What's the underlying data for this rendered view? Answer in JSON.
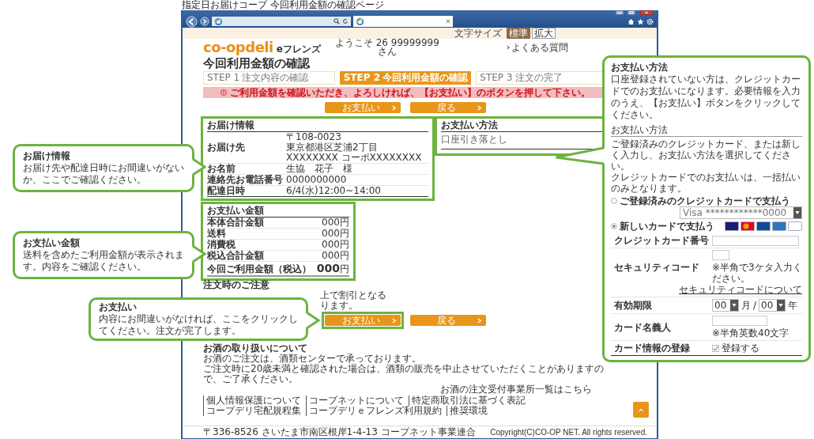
{
  "caption": "指定日お届けコープ 今回利用金額の確認ページ",
  "font_size": {
    "label": "文字サイズ",
    "options": [
      {
        "label": "標準",
        "selected": true
      },
      {
        "label": "拡大",
        "selected": false
      }
    ]
  },
  "header": {
    "logo": "co-opdeli",
    "logo_sub": "eフレンズ",
    "welcome": "ようこそ 26 99999999",
    "welcome_suffix": "さん",
    "faq_link": "よくある質問"
  },
  "page_title": "今回利用金額の確認",
  "steps": [
    {
      "step": "STEP 1",
      "label": "注文内容の確認",
      "selected": false
    },
    {
      "step": "STEP 2",
      "label": "今回利用金額の確認",
      "selected": true
    },
    {
      "step": "STEP 3",
      "label": "注文の完了",
      "selected": false
    }
  ],
  "alert": "ご利用金額を確認いただき、よろしければ、【お支払い】のボタンを押して下さい。",
  "actions_top": [
    {
      "label": "お支払い",
      "highlighted": false
    },
    {
      "label": "戻る",
      "highlighted": false
    }
  ],
  "delivery": {
    "title": "お届け情報",
    "highlighted": true,
    "rows": [
      {
        "label": "お届け先",
        "lines": [
          "〒108-0023",
          "東京都港区芝浦2丁目 XXXXXXXX コーポXXXXXXXX"
        ]
      },
      {
        "label": "お名前",
        "lines": [
          "生協　花子　様"
        ]
      },
      {
        "label": "連絡先お電話番号",
        "lines": [
          "0000000000"
        ]
      },
      {
        "label": "配達日時",
        "lines": [
          "6/4(水)12:00~14:00"
        ]
      }
    ]
  },
  "payment_method": {
    "title": "お支払い方法",
    "value": "口座引き落とし",
    "highlighted": true
  },
  "amount": {
    "title": "お支払い金額",
    "highlighted": true,
    "rows": [
      {
        "label": "本体合計金額",
        "value": "000円"
      },
      {
        "label": "送料",
        "value": "000円"
      },
      {
        "label": "消費税",
        "value": "000円"
      },
      {
        "label": "税込合計金額",
        "value": "000円"
      }
    ],
    "total": {
      "label": "今回ご利用金額（税込）",
      "value": "000",
      "unit": "円"
    }
  },
  "notes": {
    "title": "注文時のご注意",
    "lines": [
      "上で割引となる",
      "ります。"
    ]
  },
  "actions_bottom": [
    {
      "label": "お支払い",
      "highlighted": true
    },
    {
      "label": "戻る",
      "highlighted": false
    }
  ],
  "alcohol": {
    "title": "お酒の取り扱いについて",
    "lines": [
      "お酒のご注文は、酒類センターで承っております。",
      "ご注文時に20歳未満と確認された場合は、酒類の販売を中止させていただくことがありますので、ご了承ください。"
    ],
    "link": "お酒の注文受付事業所一覧はこちら"
  },
  "footer_links": [
    "個人情報保護について",
    "コープネットについて",
    "特定商取引法に基づく表記",
    "コープデリ宅配規程集",
    "コープデリｅフレンズ利用規約",
    "推奨環境"
  ],
  "footer": {
    "address": "〒336-8526 さいたま市南区根岸1-4-13 コープネット事業連合",
    "copyright": "Copyright(C)CO-OP NET. All rights reserved."
  },
  "callouts": [
    {
      "title": "お届け情報",
      "text": "お届け先や配達日時にお間違いがないか、ここでご確認ください。"
    },
    {
      "title": "お支払い金額",
      "text": "送料を含めたご利用金額が表示されます。内容をご確認ください。"
    },
    {
      "title": "お支払い",
      "text": "内容にお間違いがなければ、ここをクリックしてください。注文が完了します。"
    },
    {
      "title": "お支払い方法",
      "text": "口座登録されていない方は、クレジットカードでのお支払いになります。必要情報を入力のうえ、【お支払い】ボタンをクリックしてください。",
      "form": {
        "title": "お支払い方法",
        "notes": [
          "ご登録済みのクレジットカード、または新しく入力し、お支払い方法を選択してください。",
          "クレジットカードでのお支払いは、一括払いのみとなります。"
        ],
        "options": [
          {
            "label": "ご登録済みのクレジットカードで支払う",
            "selected": false,
            "card_select": "Visa ************0000"
          },
          {
            "label": "新しいカードで支払う",
            "selected": true
          }
        ],
        "fields": [
          {
            "kind": "text",
            "label": "クレジットカード番号"
          },
          {
            "kind": "code",
            "label": "セキュリティコード",
            "hint": "※半角で3ケタ入力ください。",
            "link": "セキュリティコードについて"
          },
          {
            "kind": "expiry",
            "label": "有効期限",
            "month": "00",
            "month_unit": "月",
            "separator": "/",
            "year": "00",
            "year_unit": "年"
          },
          {
            "kind": "name",
            "label": "カード名義人",
            "hint": "※半角英数40文字"
          },
          {
            "kind": "checkbox",
            "label": "カード情報の登録",
            "option": "登録する",
            "checked": true
          }
        ]
      }
    }
  ]
}
